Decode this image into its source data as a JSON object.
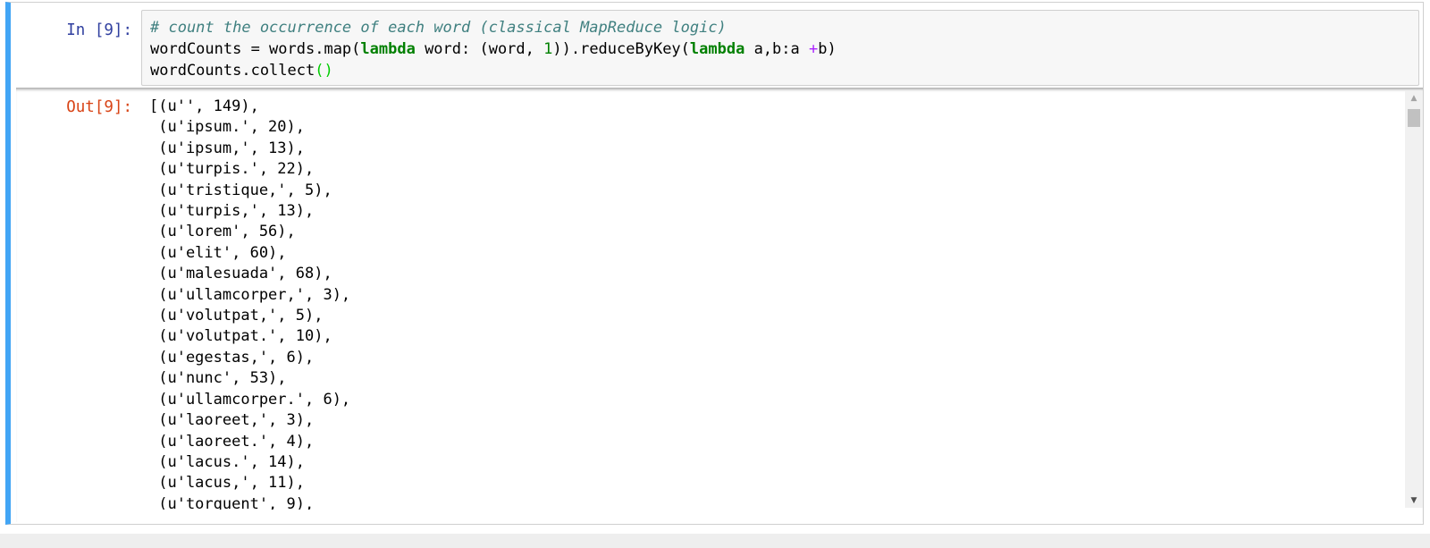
{
  "cell": {
    "in_prompt": "In [9]:",
    "out_prompt": "Out[9]:",
    "code": {
      "line1_comment": "# count the occurrence of each word (classical MapReduce logic)",
      "line2_a": "wordCounts = words.map(",
      "line2_kw1": "lambda",
      "line2_b": " word: (word, ",
      "line2_num": "1",
      "line2_c": ")).reduceByKey(",
      "line2_kw2": "lambda",
      "line2_d": " a,b:a ",
      "line2_op": "+",
      "line2_e": "b)",
      "line3_a": "wordCounts.collect",
      "line3_paren": "()"
    },
    "output_lines": [
      "[(u'', 149),",
      " (u'ipsum.', 20),",
      " (u'ipsum,', 13),",
      " (u'turpis.', 22),",
      " (u'tristique,', 5),",
      " (u'turpis,', 13),",
      " (u'lorem', 56),",
      " (u'elit', 60),",
      " (u'malesuada', 68),",
      " (u'ullamcorper,', 3),",
      " (u'volutpat,', 5),",
      " (u'volutpat.', 10),",
      " (u'egestas,', 6),",
      " (u'nunc', 53),",
      " (u'ullamcorper.', 6),",
      " (u'laoreet,', 3),",
      " (u'laoreet.', 4),",
      " (u'lacus.', 14),",
      " (u'lacus,', 11),",
      " (u'torquent', 9),"
    ]
  },
  "colors": {
    "cell_selected_border": "#42a5f5",
    "in_prompt": "#303f9f",
    "out_prompt": "#d84315",
    "keyword": "#008000",
    "comment": "#408080",
    "operator": "#aa22ff"
  },
  "icons": {
    "scroll_up": "triangle-up",
    "scroll_down": "triangle-down"
  }
}
